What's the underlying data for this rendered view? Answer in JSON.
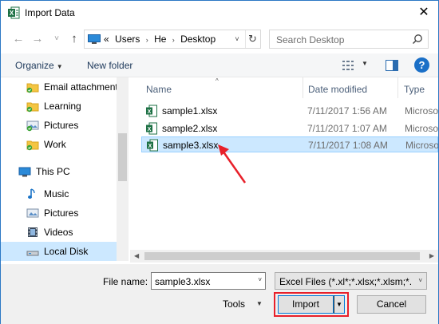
{
  "window": {
    "title": "Import Data",
    "app_icon": "excel-icon",
    "close_glyph": "✕"
  },
  "address": {
    "back_glyph": "←",
    "forward_glyph": "→",
    "history_glyph": "˅",
    "up_glyph": "↑",
    "overflow": "«",
    "crumbs": [
      "Users",
      "He",
      "Desktop"
    ],
    "separator": "›",
    "dropdown_glyph": "˅",
    "refresh_glyph": "↻"
  },
  "search": {
    "placeholder": "Search Desktop"
  },
  "toolbar": {
    "organize_label": "Organize",
    "caret": "▼",
    "new_folder_label": "New folder",
    "help_label": "?"
  },
  "nav": {
    "items": [
      {
        "label": "Email attachment",
        "icon": "folder-check-icon"
      },
      {
        "label": "Learning",
        "icon": "folder-check-icon"
      },
      {
        "label": "Pictures",
        "icon": "pictures-check-icon"
      },
      {
        "label": "Work",
        "icon": "folder-check-icon"
      },
      {
        "label": "This PC",
        "icon": "pc-icon"
      },
      {
        "label": "Music",
        "icon": "music-icon"
      },
      {
        "label": "Pictures",
        "icon": "pictures-icon"
      },
      {
        "label": "Videos",
        "icon": "videos-icon"
      },
      {
        "label": "Local Disk",
        "icon": "disk-icon"
      }
    ],
    "selected_index": 8
  },
  "filelist": {
    "columns": {
      "name": "Name",
      "date": "Date modified",
      "type": "Type"
    },
    "sort_glyph": "^",
    "files": [
      {
        "name": "sample1.xlsx",
        "date": "7/11/2017 1:56 AM",
        "type": "Microsoft"
      },
      {
        "name": "sample2.xlsx",
        "date": "7/11/2017 1:07 AM",
        "type": "Microsoft"
      },
      {
        "name": "sample3.xlsx",
        "date": "7/11/2017 1:08 AM",
        "type": "Microsoft"
      }
    ],
    "selected_index": 2
  },
  "bottom": {
    "file_name_label": "File name:",
    "file_name_value": "sample3.xlsx",
    "filter_value": "Excel Files (*.xl*;*.xlsx;*.xlsm;*.xl",
    "tools_label": "Tools",
    "import_label": "Import",
    "cancel_label": "Cancel"
  },
  "colors": {
    "accent": "#0078d7",
    "selection": "#cce8ff",
    "annotation": "#e8202a",
    "excel_green": "#1e7145"
  }
}
